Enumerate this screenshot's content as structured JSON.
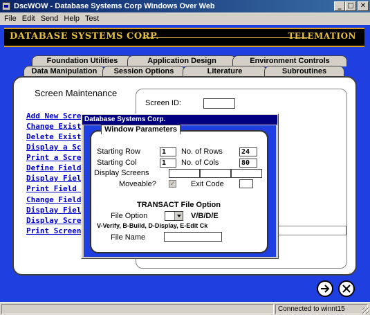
{
  "window": {
    "title": "DscWOW - Database Systems Corp Windows Over Web",
    "btn_min": "_",
    "btn_max": "□",
    "btn_close": "✕"
  },
  "menu": {
    "file": "File",
    "edit": "Edit",
    "send": "Send",
    "help": "Help",
    "test": "Test"
  },
  "banner": {
    "left": "DATABASE SYSTEMS CORP.",
    "right": "TELEMATION"
  },
  "tabs_row1": [
    "Foundation Utilities",
    "Application Design",
    "Environment Controls"
  ],
  "tabs_row2": [
    "Data Manipulation",
    "Session Options",
    "Literature",
    "Subroutines"
  ],
  "screen": {
    "title": "Screen Maintenance",
    "links": [
      "Add New Screen",
      "Change Existing",
      "Delete Existing",
      "Display a Screen",
      "Print a Screen",
      "Define Field",
      "Display Field",
      "Print Field Def",
      "Change Field",
      "Display Field",
      "Display Screen",
      "Print Screen"
    ],
    "screen_id_label": "Screen ID:"
  },
  "dialog": {
    "title": "Database Systems Corp.",
    "group_label": "Window Parameters",
    "starting_row_label": "Starting Row",
    "starting_row_value": "1",
    "no_rows_label": "No. of Rows",
    "no_rows_value": "24",
    "starting_col_label": "Starting Col",
    "starting_col_value": "1",
    "no_cols_label": "No. of Cols",
    "no_cols_value": "80",
    "display_screens_label": "Display Screens",
    "moveable_label": "Moveable?",
    "moveable_check": "✓",
    "exit_code_label": "Exit Code",
    "transact_title": "TRANSACT File Option",
    "file_option_label": "File Option",
    "file_option_codes": "V/B/D/E",
    "file_option_help": "V-Verify, B-Build, D-Display, E-Edit Ck",
    "file_name_label": "File Name"
  },
  "status": {
    "left": "",
    "right": "Connected to winnt15"
  },
  "icons": {
    "next": "next-arrow-icon",
    "close": "close-circle-icon"
  }
}
